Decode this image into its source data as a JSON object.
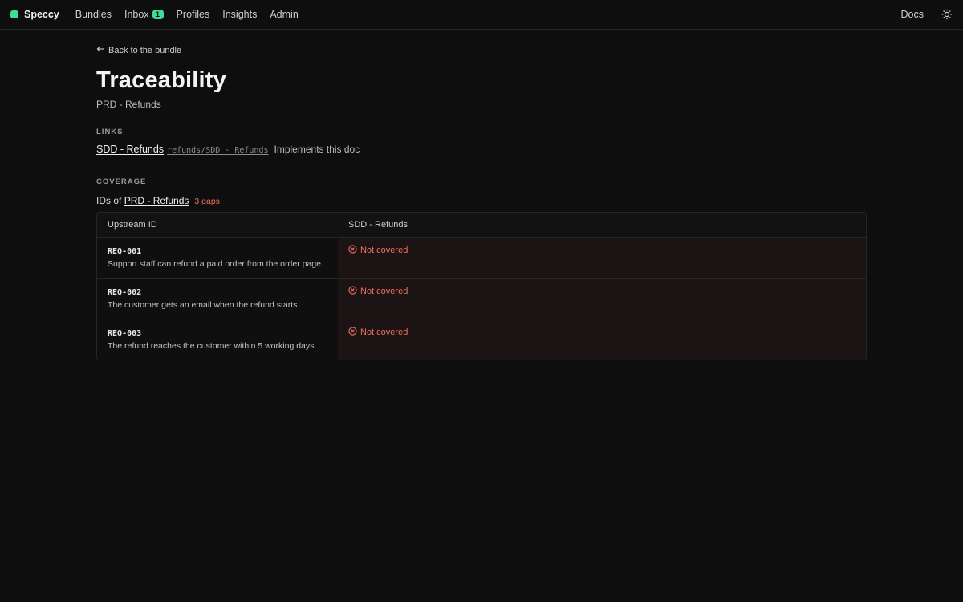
{
  "topbar": {
    "brand": "Speccy",
    "nav": [
      {
        "label": "Bundles"
      },
      {
        "label": "Inbox",
        "badge": "1"
      },
      {
        "label": "Profiles"
      },
      {
        "label": "Insights"
      },
      {
        "label": "Admin"
      }
    ],
    "docs": "Docs",
    "theme_icon": "sun-icon"
  },
  "page": {
    "back_label": "Back to the bundle",
    "title": "Traceability",
    "subtitle": "PRD - Refunds"
  },
  "links": {
    "label": "LINKS",
    "items": [
      {
        "name": "SDD - Refunds",
        "path": "refunds/SDD - Refunds",
        "description": "Implements this doc"
      }
    ]
  },
  "coverage": {
    "label": "COVERAGE",
    "ids_prefix": "IDs of",
    "ids_doc": "PRD - Refunds",
    "gaps": "3 gaps",
    "columns": [
      "Upstream ID",
      "SDD - Refunds"
    ],
    "rows": [
      {
        "id": "REQ-001",
        "text": "Support staff can refund a paid order from the order page.",
        "status": "Not covered"
      },
      {
        "id": "REQ-002",
        "text": "The customer gets an email when the refund starts.",
        "status": "Not covered"
      },
      {
        "id": "REQ-003",
        "text": "The refund reaches the customer within 5 working days.",
        "status": "Not covered"
      }
    ]
  },
  "colors": {
    "accent": "#3ddc97",
    "gap": "#f07060",
    "background": "#0e0e0e"
  }
}
